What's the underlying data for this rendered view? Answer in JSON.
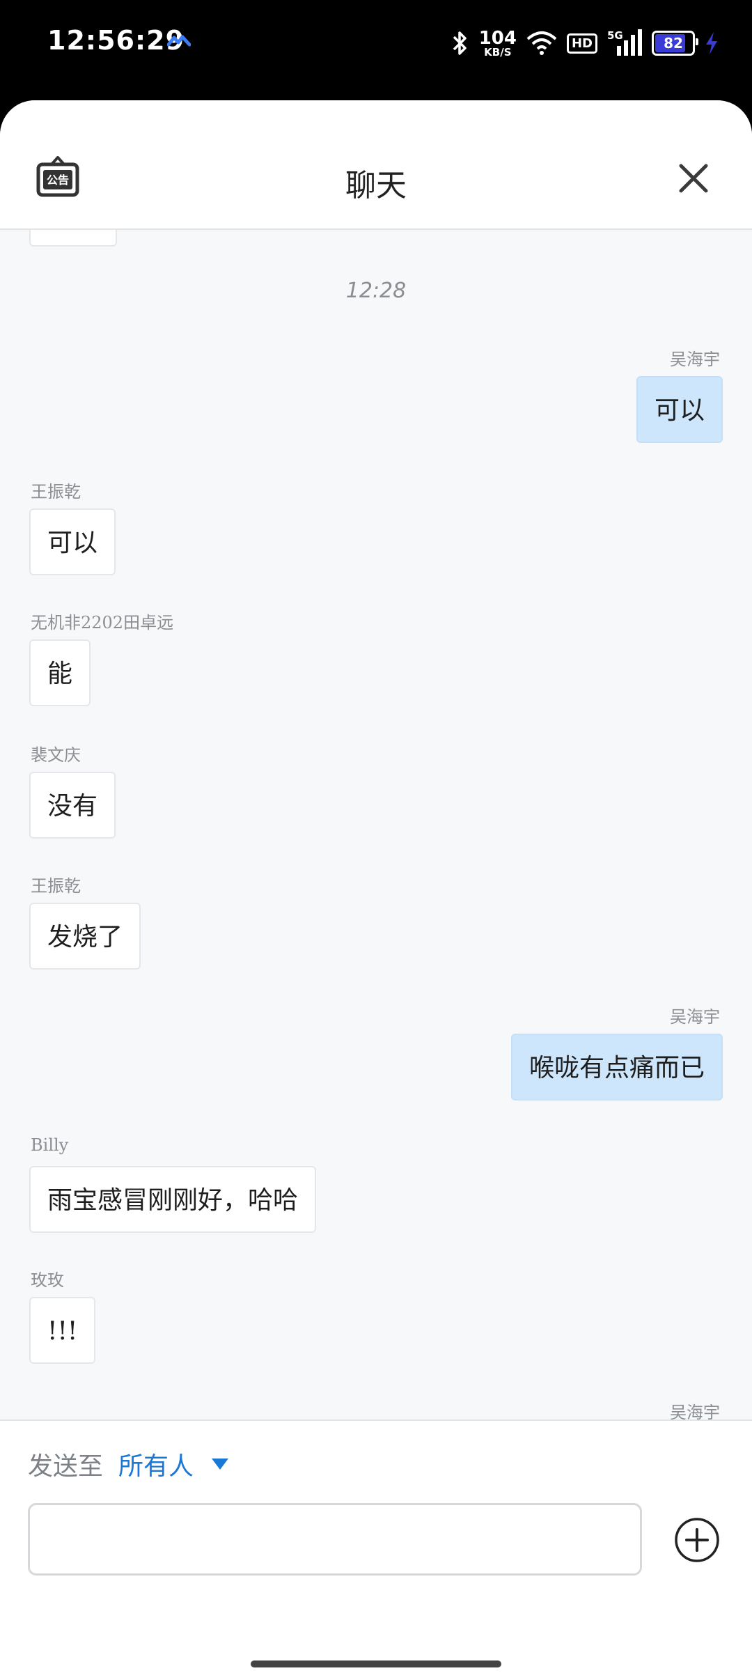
{
  "status_bar": {
    "time": "12:56:29",
    "net_speed_value": "104",
    "net_speed_unit": "KB/S",
    "hd_badge": "HD",
    "signal_label": "5G",
    "battery_level": "82"
  },
  "header": {
    "title": "聊天",
    "notice_icon": "announcement-icon",
    "close_icon": "close-icon"
  },
  "chat": {
    "timestamp": "12:28",
    "messages": [
      {
        "sender": "吴海宇",
        "text": "可以",
        "side": "right"
      },
      {
        "sender": "王振乾",
        "text": "可以",
        "side": "left"
      },
      {
        "sender": "无机非2202田卓远",
        "text": "能",
        "side": "left"
      },
      {
        "sender": "裴文庆",
        "text": "没有",
        "side": "left"
      },
      {
        "sender": "王振乾",
        "text": "发烧了",
        "side": "left"
      },
      {
        "sender": "吴海宇",
        "text": "喉咙有点痛而已",
        "side": "right"
      },
      {
        "sender": "Billy",
        "text": "雨宝感冒刚刚好，哈哈",
        "side": "left"
      },
      {
        "sender": "玫玫",
        "text": "!!!",
        "side": "left"
      },
      {
        "sender": "吴海宇",
        "text": "",
        "side": "right"
      }
    ]
  },
  "composer": {
    "send_to_label": "发送至",
    "send_to_target": "所有人",
    "input_value": "",
    "plus_icon": "add-icon"
  },
  "colors": {
    "accent": "#1c78d6",
    "own_bubble": "#cde6fb",
    "background": "#f7f8fa"
  }
}
